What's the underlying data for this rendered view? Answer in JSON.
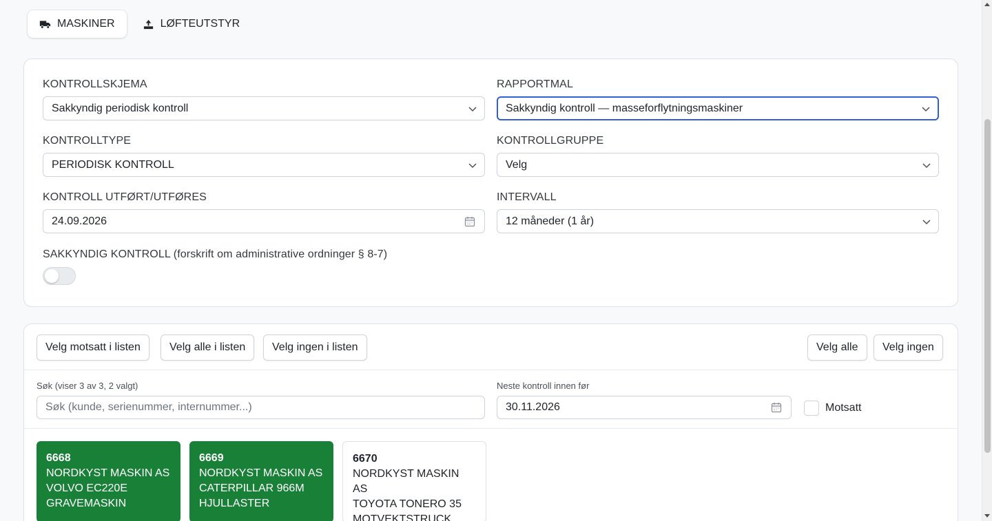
{
  "tabs": [
    {
      "label": "MASKINER",
      "icon": "truck-icon",
      "active": true
    },
    {
      "label": "LØFTEUTSTYR",
      "icon": "lift-icon",
      "active": false
    }
  ],
  "form": {
    "kontrollskjema": {
      "label": "KONTROLLSKJEMA",
      "value": "Sakkyndig periodisk kontroll"
    },
    "rapportmal": {
      "label": "RAPPORTMAL",
      "value": "Sakkyndig kontroll — masseforflytningsmaskiner"
    },
    "kontrolltype": {
      "label": "KONTROLLTYPE",
      "value": "PERIODISK KONTROLL"
    },
    "kontrollgruppe": {
      "label": "KONTROLLGRUPPE",
      "value": "Velg"
    },
    "kontroll_utfort": {
      "label": "KONTROLL UTFØRT/UTFØRES",
      "value": "24.09.2026"
    },
    "intervall": {
      "label": "INTERVALL",
      "value": "12 måneder (1 år)"
    },
    "sakkyndig": {
      "label": "SAKKYNDIG KONTROLL (forskrift om administrative ordninger § 8-7)",
      "enabled": false
    }
  },
  "list_actions": {
    "velg_motsatt": "Velg motsatt i listen",
    "velg_alle_listen": "Velg alle i listen",
    "velg_ingen_listen": "Velg ingen i listen",
    "velg_alle": "Velg alle",
    "velg_ingen": "Velg ingen"
  },
  "filters": {
    "search_label": "Søk (viser 3 av 3, 2 valgt)",
    "search_placeholder": "Søk (kunde, serienummer, internummer...)",
    "neste_label": "Neste kontroll innen før",
    "neste_value": "30.11.2026",
    "motsatt_label": "Motsatt",
    "motsatt_checked": false
  },
  "machines": [
    {
      "number": "6668",
      "customer": "NORDKYST MASKIN AS",
      "model": "VOLVO EC220E",
      "type": "GRAVEMASKIN",
      "selected": true
    },
    {
      "number": "6669",
      "customer": "NORDKYST MASKIN AS",
      "model": "CATERPILLAR 966M",
      "type": "HJULLASTER",
      "selected": true
    },
    {
      "number": "6670",
      "customer": "NORDKYST MASKIN AS",
      "model": "TOYOTA TONERO 35",
      "type": "MOTVEKTSTRUCK",
      "selected": false
    }
  ],
  "colors": {
    "selected": "#198038",
    "focus": "#2f5fd0"
  }
}
